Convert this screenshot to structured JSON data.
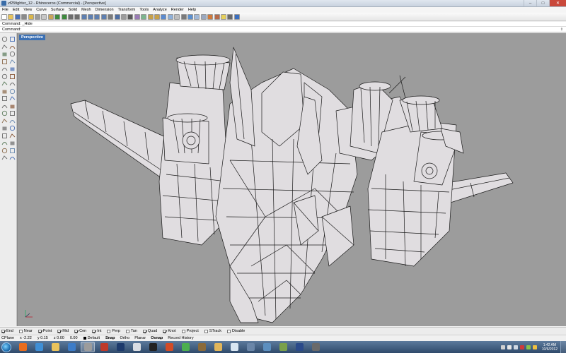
{
  "window": {
    "title": "vf25fighter_12 - Rhinoceros (Commercial) - [Perspective]",
    "minimize_glyph": "–",
    "maximize_glyph": "□",
    "close_glyph": "✕"
  },
  "menu": [
    "File",
    "Edit",
    "View",
    "Curve",
    "Surface",
    "Solid",
    "Mesh",
    "Dimension",
    "Transform",
    "Tools",
    "Analyze",
    "Render",
    "Help"
  ],
  "toolbar": {
    "icons": [
      {
        "name": "new-icon",
        "color": "#ffffff"
      },
      {
        "name": "open-icon",
        "color": "#e8c45a"
      },
      {
        "name": "save-icon",
        "color": "#4a6fb5"
      },
      {
        "name": "print-icon",
        "color": "#8a8a8a"
      },
      {
        "name": "import-icon",
        "color": "#d9b64a"
      },
      {
        "name": "cut-icon",
        "color": "#9a9a9a"
      },
      {
        "name": "copy-icon",
        "color": "#c7c7c7"
      },
      {
        "name": "paste-icon",
        "color": "#c9a45a"
      },
      {
        "name": "undo-icon",
        "color": "#3d8a3d"
      },
      {
        "name": "redo-icon",
        "color": "#3d8a3d"
      },
      {
        "name": "pan-icon",
        "color": "#6b6b6b"
      },
      {
        "name": "rotate-view-icon",
        "color": "#6b6b6b"
      },
      {
        "name": "zoom-dynamic-icon",
        "color": "#5e7fb0"
      },
      {
        "name": "zoom-window-icon",
        "color": "#5e7fb0"
      },
      {
        "name": "zoom-extents-icon",
        "color": "#5e7fb0"
      },
      {
        "name": "zoom-selected-icon",
        "color": "#5e7fb0"
      },
      {
        "name": "undo-view-icon",
        "color": "#7b7b7b"
      },
      {
        "name": "four-viewports-icon",
        "color": "#4e6ea3"
      },
      {
        "name": "grid-icon",
        "color": "#9c9c9c"
      },
      {
        "name": "select-icon",
        "color": "#5a5a5a"
      },
      {
        "name": "hide-icon",
        "color": "#9a7bb5"
      },
      {
        "name": "show-icon",
        "color": "#7bb58d"
      },
      {
        "name": "lock-icon",
        "color": "#c6a04a"
      },
      {
        "name": "unlock-icon",
        "color": "#c6a04a"
      },
      {
        "name": "layers-icon",
        "color": "#5b8bd0"
      },
      {
        "name": "properties-icon",
        "color": "#8fb0d8"
      },
      {
        "name": "wireframe-icon",
        "color": "#bdbdbd"
      },
      {
        "name": "shaded-icon",
        "color": "#7a7a7a"
      },
      {
        "name": "rendered-icon",
        "color": "#5a8fcf"
      },
      {
        "name": "ghosted-icon",
        "color": "#a0b8d8"
      },
      {
        "name": "xray-icon",
        "color": "#9aa8c0"
      },
      {
        "name": "render-icon",
        "color": "#d07a3a"
      },
      {
        "name": "material-icon",
        "color": "#b66a4a"
      },
      {
        "name": "light-icon",
        "color": "#e6d05a"
      },
      {
        "name": "options-icon",
        "color": "#6a6a6a"
      },
      {
        "name": "help-icon",
        "color": "#3a6fc0"
      }
    ]
  },
  "command": {
    "history": "Command: _Hide",
    "prompt": "Command:",
    "value": "",
    "scroll_glyph": "⇕"
  },
  "palette": {
    "icons": [
      "point-icon",
      "pin-icon",
      "polyline-icon",
      "curve-icon",
      "circle-icon",
      "arc-icon",
      "ellipse-icon",
      "rectangle-icon",
      "polygon-icon",
      "text-icon",
      "fillet-icon",
      "offset-icon",
      "surface-icon",
      "extrude-icon",
      "loft-icon",
      "sweep-icon",
      "box-icon",
      "sphere-icon",
      "cylinder-icon",
      "boolean-icon",
      "mesh-icon",
      "trim-icon",
      "split-icon",
      "join-icon",
      "explode-icon",
      "move-icon",
      "transform-icon",
      "array-icon",
      "dimension-icon",
      "gumball-icon",
      "analyze-icon",
      "render-sphere-icon",
      "zebra-icon",
      "properties-icon"
    ]
  },
  "viewport": {
    "label": "Perspective",
    "background": "#9c9c9c",
    "model_fill": "#e0dde0",
    "edge_color": "#1a1a1a"
  },
  "osnap": [
    {
      "label": "End",
      "checked": true
    },
    {
      "label": "Near",
      "checked": false
    },
    {
      "label": "Point",
      "checked": true
    },
    {
      "label": "Mid",
      "checked": true
    },
    {
      "label": "Cen",
      "checked": true
    },
    {
      "label": "Int",
      "checked": true
    },
    {
      "label": "Perp",
      "checked": false
    },
    {
      "label": "Tan",
      "checked": false
    },
    {
      "label": "Quad",
      "checked": true
    },
    {
      "label": "Knot",
      "checked": true
    },
    {
      "label": "Project",
      "checked": false
    },
    {
      "label": "STrack",
      "checked": false
    },
    {
      "label": "Disable",
      "checked": false
    }
  ],
  "status": {
    "cplane": "CPlane",
    "x": "x -2.22",
    "y": "y 0.15",
    "z": "z 0.00",
    "elevation": "0.00",
    "layer": "Default",
    "toggles": [
      {
        "label": "Snap",
        "on": true
      },
      {
        "label": "Ortho",
        "on": false
      },
      {
        "label": "Planar",
        "on": false
      },
      {
        "label": "Osnap",
        "on": true
      },
      {
        "label": "Record History",
        "on": false
      }
    ]
  },
  "taskbar": {
    "apps": [
      {
        "name": "firefox-icon",
        "color": "#e86d1f",
        "active": false
      },
      {
        "name": "internet-explorer-icon",
        "color": "#3f8fd6",
        "active": false
      },
      {
        "name": "file-explorer-icon",
        "color": "#e9c35c",
        "active": false
      },
      {
        "name": "media-player-icon",
        "color": "#3c7cc8",
        "active": false
      },
      {
        "name": "rhino-icon",
        "color": "#9c9c9c",
        "active": true
      },
      {
        "name": "rhino-render-icon",
        "color": "#bf3a2a",
        "active": false
      },
      {
        "name": "photoshop-icon",
        "color": "#1d3a6c",
        "active": false
      },
      {
        "name": "app-swirl-icon",
        "color": "#d9dde3",
        "active": false
      },
      {
        "name": "zbrush-icon",
        "color": "#222222",
        "active": false
      },
      {
        "name": "powerpoint-icon",
        "color": "#d24b26",
        "active": false
      },
      {
        "name": "chrome-icon",
        "color": "#4caf50",
        "active": false
      },
      {
        "name": "game-icon",
        "color": "#8a6a3a",
        "active": false
      },
      {
        "name": "paint-icon",
        "color": "#e0b55a",
        "active": false
      },
      {
        "name": "notepad-icon",
        "color": "#d8e6f2",
        "active": false
      },
      {
        "name": "calculator-icon",
        "color": "#6a86a8",
        "active": false
      },
      {
        "name": "control-panel-icon",
        "color": "#5c8fbf",
        "active": false
      },
      {
        "name": "people-icon",
        "color": "#7aa04a",
        "active": false
      },
      {
        "name": "eye-icon",
        "color": "#2a4a8a",
        "active": false
      },
      {
        "name": "pen-icon",
        "color": "#6a6a6a",
        "active": false
      }
    ],
    "tray": [
      {
        "name": "tray-flag-icon",
        "color": "#d0d0d0"
      },
      {
        "name": "tray-network-icon",
        "color": "#e6e6e6"
      },
      {
        "name": "tray-sound-icon",
        "color": "#cfd8e3"
      },
      {
        "name": "tray-antivirus-icon",
        "color": "#d03a3a"
      },
      {
        "name": "tray-battery-icon",
        "color": "#8bc34a"
      },
      {
        "name": "tray-update-icon",
        "color": "#f0c040"
      }
    ],
    "time": "1:42 AM",
    "date": "10/6/2012"
  }
}
